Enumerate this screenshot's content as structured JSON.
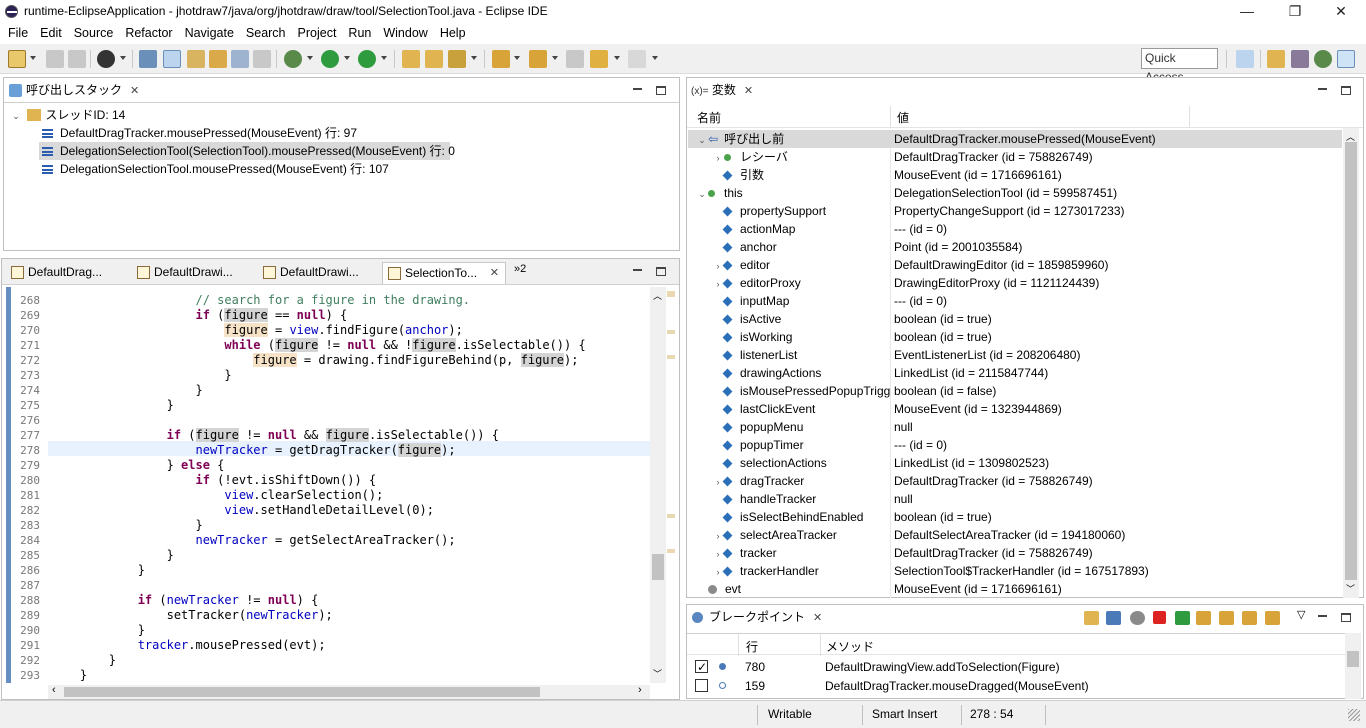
{
  "window": {
    "title": "runtime-EclipseApplication - jhotdraw7/java/org/jhotdraw/draw/tool/SelectionTool.java - Eclipse IDE",
    "min_glyph": "—",
    "restore_glyph": "❐",
    "close_glyph": "✕"
  },
  "menu": [
    "File",
    "Edit",
    "Source",
    "Refactor",
    "Navigate",
    "Search",
    "Project",
    "Run",
    "Window",
    "Help"
  ],
  "toolbar": {
    "quick_access": "Quick Access"
  },
  "callstack": {
    "tab_label": "呼び出しスタック",
    "thread": "スレッドID: 14",
    "frames": [
      "DefaultDragTracker.mousePressed(MouseEvent) 行: 97",
      "DelegationSelectionTool(SelectionTool).mousePressed(MouseEvent) 行: 0",
      "DelegationSelectionTool.mousePressed(MouseEvent) 行: 107"
    ]
  },
  "editor": {
    "tabs": [
      "DefaultDrag...",
      "DefaultDrawi...",
      "DefaultDrawi...",
      "SelectionTo..."
    ],
    "overflow": "»2",
    "lines": [
      {
        "n": "268",
        "html": "                    <span class=\"cm\">// search for a figure in the drawing.</span>"
      },
      {
        "n": "269",
        "html": "                    <span class=\"kw\">if</span> (<span class=\"hl\">figure</span> == <span class=\"kw\">null</span>) {"
      },
      {
        "n": "270",
        "html": "                        <span class=\"hlf\">figure</span> = <span class=\"fld\">view</span>.findFigure(<span class=\"fld\">anchor</span>);"
      },
      {
        "n": "271",
        "html": "                        <span class=\"kw\">while</span> (<span class=\"hl\">figure</span> != <span class=\"kw\">null</span> &amp;&amp; !<span class=\"hl\">figure</span>.isSelectable()) {"
      },
      {
        "n": "272",
        "html": "                            <span class=\"hlf\">figure</span> = drawing.findFigureBehind(p, <span class=\"hl\">figure</span>);"
      },
      {
        "n": "273",
        "html": "                        }"
      },
      {
        "n": "274",
        "html": "                    }"
      },
      {
        "n": "275",
        "html": "                }"
      },
      {
        "n": "276",
        "html": ""
      },
      {
        "n": "277",
        "html": "                <span class=\"kw\">if</span> (<span class=\"hl\">figure</span> != <span class=\"kw\">null</span> &amp;&amp; <span class=\"hl\">figure</span>.isSelectable()) {"
      },
      {
        "n": "278",
        "html": "                    <span class=\"fld\">newTracker</span> = getDragTracker(<span class=\"hl\">figure</span>);"
      },
      {
        "n": "279",
        "html": "                } <span class=\"kw\">else</span> {"
      },
      {
        "n": "280",
        "html": "                    <span class=\"kw\">if</span> (!evt.isShiftDown()) {"
      },
      {
        "n": "281",
        "html": "                        <span class=\"fld\">view</span>.clearSelection();"
      },
      {
        "n": "282",
        "html": "                        <span class=\"fld\">view</span>.setHandleDetailLevel(0);"
      },
      {
        "n": "283",
        "html": "                    }"
      },
      {
        "n": "284",
        "html": "                    <span class=\"fld\">newTracker</span> = getSelectAreaTracker();"
      },
      {
        "n": "285",
        "html": "                }"
      },
      {
        "n": "286",
        "html": "            }"
      },
      {
        "n": "287",
        "html": ""
      },
      {
        "n": "288",
        "html": "            <span class=\"kw\">if</span> (<span class=\"fld\">newTracker</span> != <span class=\"kw\">null</span>) {"
      },
      {
        "n": "289",
        "html": "                setTracker(<span class=\"fld\">newTracker</span>);"
      },
      {
        "n": "290",
        "html": "            }"
      },
      {
        "n": "291",
        "html": "            <span class=\"fld\">tracker</span>.mousePressed(evt);"
      },
      {
        "n": "292",
        "html": "        }"
      },
      {
        "n": "293",
        "html": "    }"
      }
    ]
  },
  "variables": {
    "tab_label": "変数",
    "tab_prefix": "(x)=",
    "col_name": "名前",
    "col_value": "値",
    "rows": [
      {
        "indent": 0,
        "tw": "⌄",
        "icon": "return",
        "name": "呼び出し前",
        "value": "DefaultDragTracker.mousePressed(MouseEvent)",
        "sel": true
      },
      {
        "indent": 1,
        "tw": "›",
        "icon": "dot",
        "name": "レシーバ",
        "value": "DefaultDragTracker (id = 758826749)"
      },
      {
        "indent": 1,
        "tw": "",
        "icon": "dia",
        "name": "引数",
        "value": "MouseEvent (id = 1716696161)"
      },
      {
        "indent": 0,
        "tw": "⌄",
        "icon": "dot",
        "name": "this",
        "value": "DelegationSelectionTool (id = 599587451)"
      },
      {
        "indent": 1,
        "tw": "",
        "icon": "dia",
        "name": "propertySupport",
        "value": "PropertyChangeSupport (id = 1273017233)"
      },
      {
        "indent": 1,
        "tw": "",
        "icon": "dia",
        "name": "actionMap",
        "value": "--- (id = 0)"
      },
      {
        "indent": 1,
        "tw": "",
        "icon": "dia",
        "name": "anchor",
        "value": "Point (id = 2001035584)"
      },
      {
        "indent": 1,
        "tw": "›",
        "icon": "dia",
        "name": "editor",
        "value": "DefaultDrawingEditor (id = 1859859960)"
      },
      {
        "indent": 1,
        "tw": "›",
        "icon": "dia",
        "name": "editorProxy",
        "value": "DrawingEditorProxy (id = 1121124439)"
      },
      {
        "indent": 1,
        "tw": "",
        "icon": "dia",
        "name": "inputMap",
        "value": "--- (id = 0)"
      },
      {
        "indent": 1,
        "tw": "",
        "icon": "dia",
        "name": "isActive",
        "value": "boolean (id = true)"
      },
      {
        "indent": 1,
        "tw": "",
        "icon": "dia",
        "name": "isWorking",
        "value": "boolean (id = true)"
      },
      {
        "indent": 1,
        "tw": "",
        "icon": "dia",
        "name": "listenerList",
        "value": "EventListenerList (id = 208206480)"
      },
      {
        "indent": 1,
        "tw": "",
        "icon": "dia",
        "name": "drawingActions",
        "value": "LinkedList (id = 2115847744)"
      },
      {
        "indent": 1,
        "tw": "",
        "icon": "dia",
        "name": "isMousePressedPopupTrigg",
        "value": "boolean (id = false)"
      },
      {
        "indent": 1,
        "tw": "",
        "icon": "dia",
        "name": "lastClickEvent",
        "value": "MouseEvent (id = 1323944869)"
      },
      {
        "indent": 1,
        "tw": "",
        "icon": "dia",
        "name": "popupMenu",
        "value": "null"
      },
      {
        "indent": 1,
        "tw": "",
        "icon": "dia",
        "name": "popupTimer",
        "value": "--- (id = 0)"
      },
      {
        "indent": 1,
        "tw": "",
        "icon": "dia",
        "name": "selectionActions",
        "value": "LinkedList (id = 1309802523)"
      },
      {
        "indent": 1,
        "tw": "›",
        "icon": "dia",
        "name": "dragTracker",
        "value": "DefaultDragTracker (id = 758826749)"
      },
      {
        "indent": 1,
        "tw": "",
        "icon": "dia",
        "name": "handleTracker",
        "value": "null"
      },
      {
        "indent": 1,
        "tw": "",
        "icon": "dia",
        "name": "isSelectBehindEnabled",
        "value": "boolean (id = true)"
      },
      {
        "indent": 1,
        "tw": "›",
        "icon": "dia",
        "name": "selectAreaTracker",
        "value": "DefaultSelectAreaTracker (id = 194180060)"
      },
      {
        "indent": 1,
        "tw": "›",
        "icon": "dia",
        "name": "tracker",
        "value": "DefaultDragTracker (id = 758826749)"
      },
      {
        "indent": 1,
        "tw": "›",
        "icon": "dia",
        "name": "trackerHandler",
        "value": "SelectionTool$TrackerHandler (id = 167517893)"
      },
      {
        "indent": 0,
        "tw": "",
        "icon": "gray",
        "name": "evt",
        "value": "MouseEvent (id = 1716696161)"
      }
    ]
  },
  "breakpoints": {
    "tab_label": "ブレークポイント",
    "col_line": "行",
    "col_method": "メソッド",
    "rows": [
      {
        "checked": true,
        "line": "780",
        "method": "DefaultDrawingView.addToSelection(Figure)"
      },
      {
        "checked": false,
        "line": "159",
        "method": "DefaultDragTracker.mouseDragged(MouseEvent)"
      }
    ]
  },
  "status": {
    "writable": "Writable",
    "insert": "Smart Insert",
    "position": "278 : 54"
  }
}
